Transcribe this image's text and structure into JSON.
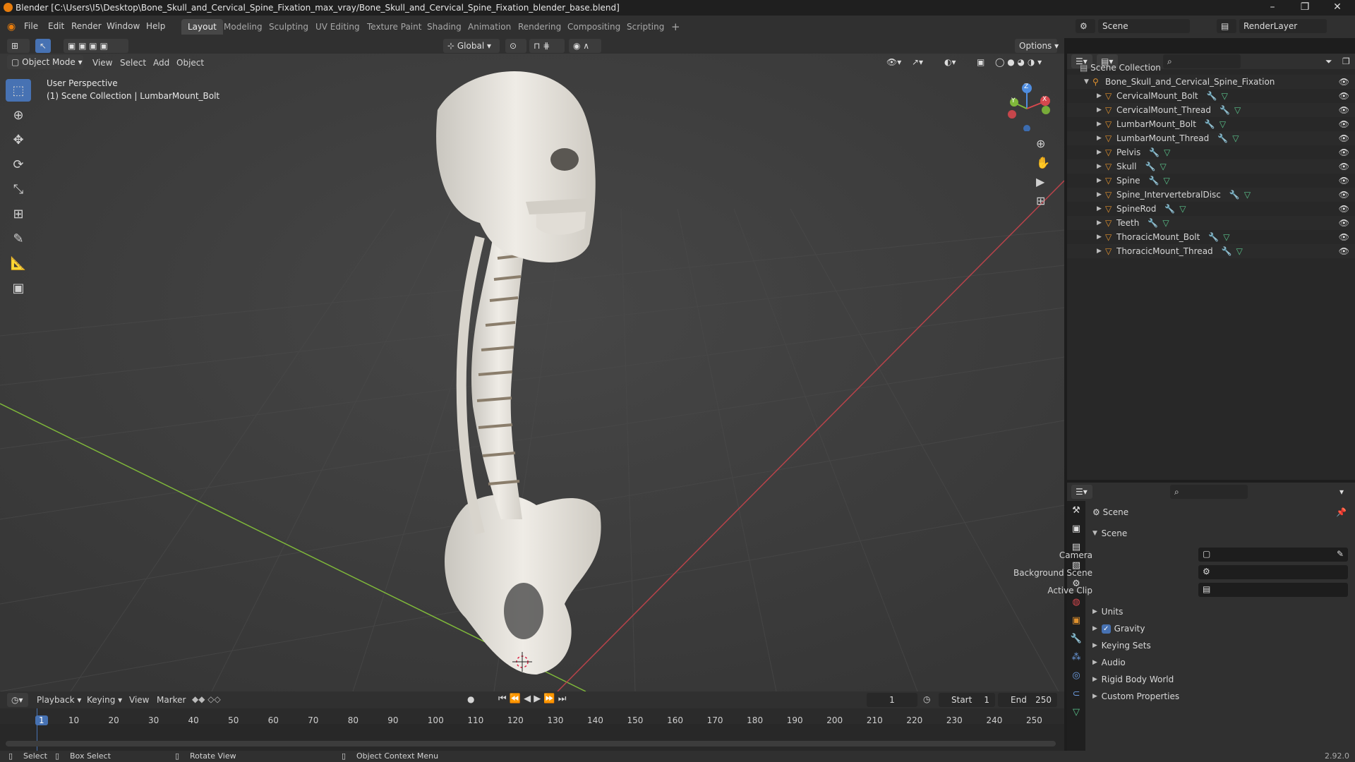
{
  "window": {
    "title": "Blender [C:\\Users\\I5\\Desktop\\Bone_Skull_and_Cervical_Spine_Fixation_max_vray/Bone_Skull_and_Cervical_Spine_Fixation_blender_base.blend]",
    "controls": [
      "–",
      "❐",
      "✕"
    ]
  },
  "menu": {
    "items": [
      "File",
      "Edit",
      "Render",
      "Window",
      "Help"
    ]
  },
  "workspaces": {
    "tabs": [
      "Layout",
      "Modeling",
      "Sculpting",
      "UV Editing",
      "Texture Paint",
      "Shading",
      "Animation",
      "Rendering",
      "Compositing",
      "Scripting"
    ],
    "active": "Layout",
    "add": "+"
  },
  "top_right": {
    "scene_name": "Scene",
    "render_layer": "RenderLayer"
  },
  "viewport_header": {
    "orientation": "Global",
    "options": "Options",
    "mode": "Object Mode",
    "menus": [
      "View",
      "Select",
      "Add",
      "Object"
    ]
  },
  "viewport": {
    "overlay_line1": "User Perspective",
    "overlay_line2": "(1) Scene Collection | LumbarMount_Bolt",
    "gizmo": {
      "x": "X",
      "y": "Y",
      "z": "Z"
    }
  },
  "outliner": {
    "root": "Scene Collection",
    "collection": "Bone_Skull_and_Cervical_Spine_Fixation",
    "objects": [
      "CervicalMount_Bolt",
      "CervicalMount_Thread",
      "LumbarMount_Bolt",
      "LumbarMount_Thread",
      "Pelvis",
      "Skull",
      "Spine",
      "Spine_IntervertebralDisc",
      "SpineRod",
      "Teeth",
      "ThoracicMount_Bolt",
      "ThoracicMount_Thread"
    ]
  },
  "properties": {
    "header": "Scene",
    "section": "Scene",
    "fields": [
      {
        "label": "Camera"
      },
      {
        "label": "Background Scene"
      },
      {
        "label": "Active Clip"
      }
    ],
    "panels": [
      "Units",
      "Gravity",
      "Keying Sets",
      "Audio",
      "Rigid Body World",
      "Custom Properties"
    ],
    "gravity_checked": true
  },
  "timeline": {
    "menus": [
      "Playback",
      "Keying",
      "View",
      "Marker"
    ],
    "current_frame": "1",
    "start_label": "Start",
    "start": "1",
    "end_label": "End",
    "end": "250",
    "ruler": [
      "1",
      "10",
      "20",
      "30",
      "40",
      "50",
      "60",
      "70",
      "80",
      "90",
      "100",
      "110",
      "120",
      "130",
      "140",
      "150",
      "160",
      "170",
      "180",
      "190",
      "200",
      "210",
      "220",
      "230",
      "240",
      "250"
    ]
  },
  "statusbar": {
    "select": "Select",
    "box_select": "Box Select",
    "rotate_view": "Rotate View",
    "context_menu": "Object Context Menu",
    "version": "2.92.0"
  },
  "colors": {
    "accent": "#4772b3",
    "x_axis": "#d6484e",
    "y_axis": "#7fb83a",
    "z_axis": "#4f8de0",
    "bone": "#e6e3dc",
    "disc": "#8a7d6b"
  }
}
